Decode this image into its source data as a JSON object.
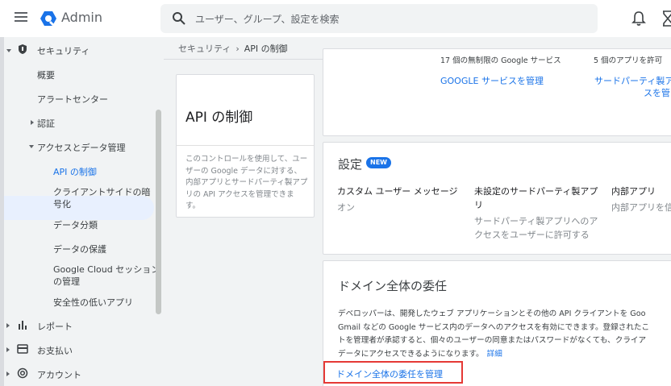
{
  "app": {
    "name": "Admin"
  },
  "search": {
    "placeholder": "ユーザー、グループ、設定を検索"
  },
  "sidebar": {
    "security": "セキュリティ",
    "items": {
      "overview": "概要",
      "alert_center": "アラートセンター",
      "auth": "認証",
      "access_data": "アクセスとデータ管理",
      "api_control": "API の制御",
      "client_side_1": "クライアントサイドの暗",
      "client_side_2": "号化",
      "data_classification": "データ分類",
      "data_protection": "データの保護",
      "gcloud_1": "Google Cloud セッション",
      "gcloud_2": "の管理",
      "less_secure": "安全性の低いアプリ",
      "reports": "レポート",
      "billing": "お支払い",
      "account": "アカウント"
    }
  },
  "breadcrumb": {
    "parent": "セキュリティ",
    "separator": "›",
    "current": "API の制御"
  },
  "api_card": {
    "title": "API の制御",
    "description": "このコントロールを使用して、ユーザーの Google データに対する、内部アプリとサードパーティ製アプリの API アクセスを管理できます。"
  },
  "top_card": {
    "partial_text_1": "17 個の無制限の Google サービス",
    "partial_text_2": "5 個のアプリを許可",
    "google_link": "GOOGLE サービスを管理",
    "third_party_link_1": "サードパーティ製ア",
    "third_party_link_2": "スを管"
  },
  "settings_card": {
    "title": "設定",
    "badge": "NEW",
    "col1_title": "カスタム ユーザー メッセージ",
    "col1_value": "オン",
    "col2_title_1": "未設定のサードパーティ製アプ",
    "col2_title_2": "リ",
    "col2_value_1": "サードパーティ製アプリへのア",
    "col2_value_2": "クセスをユーザーに許可する",
    "col3_title": "内部アプリ",
    "col3_value": "内部アプリを信"
  },
  "delegation_card": {
    "title": "ドメイン全体の委任",
    "line1": "デベロッパーは、開発したウェブ アプリケーションとその他の API クライアントを Goo",
    "line2": "Gmail などの Google サービス内のデータへのアクセスを有効にできます。登録されたこ",
    "line3": "トを管理者が承認すると、個々のユーザーの同意またはパスワードがなくても、クライア",
    "line4": "データにアクセスできるようになります。",
    "details_link": "詳細",
    "manage_button": "ドメイン全体の委任を管理"
  },
  "colors": {
    "accent": "#1a73e8",
    "highlight_border": "#e53935",
    "active_bg": "#e8f0fe"
  }
}
